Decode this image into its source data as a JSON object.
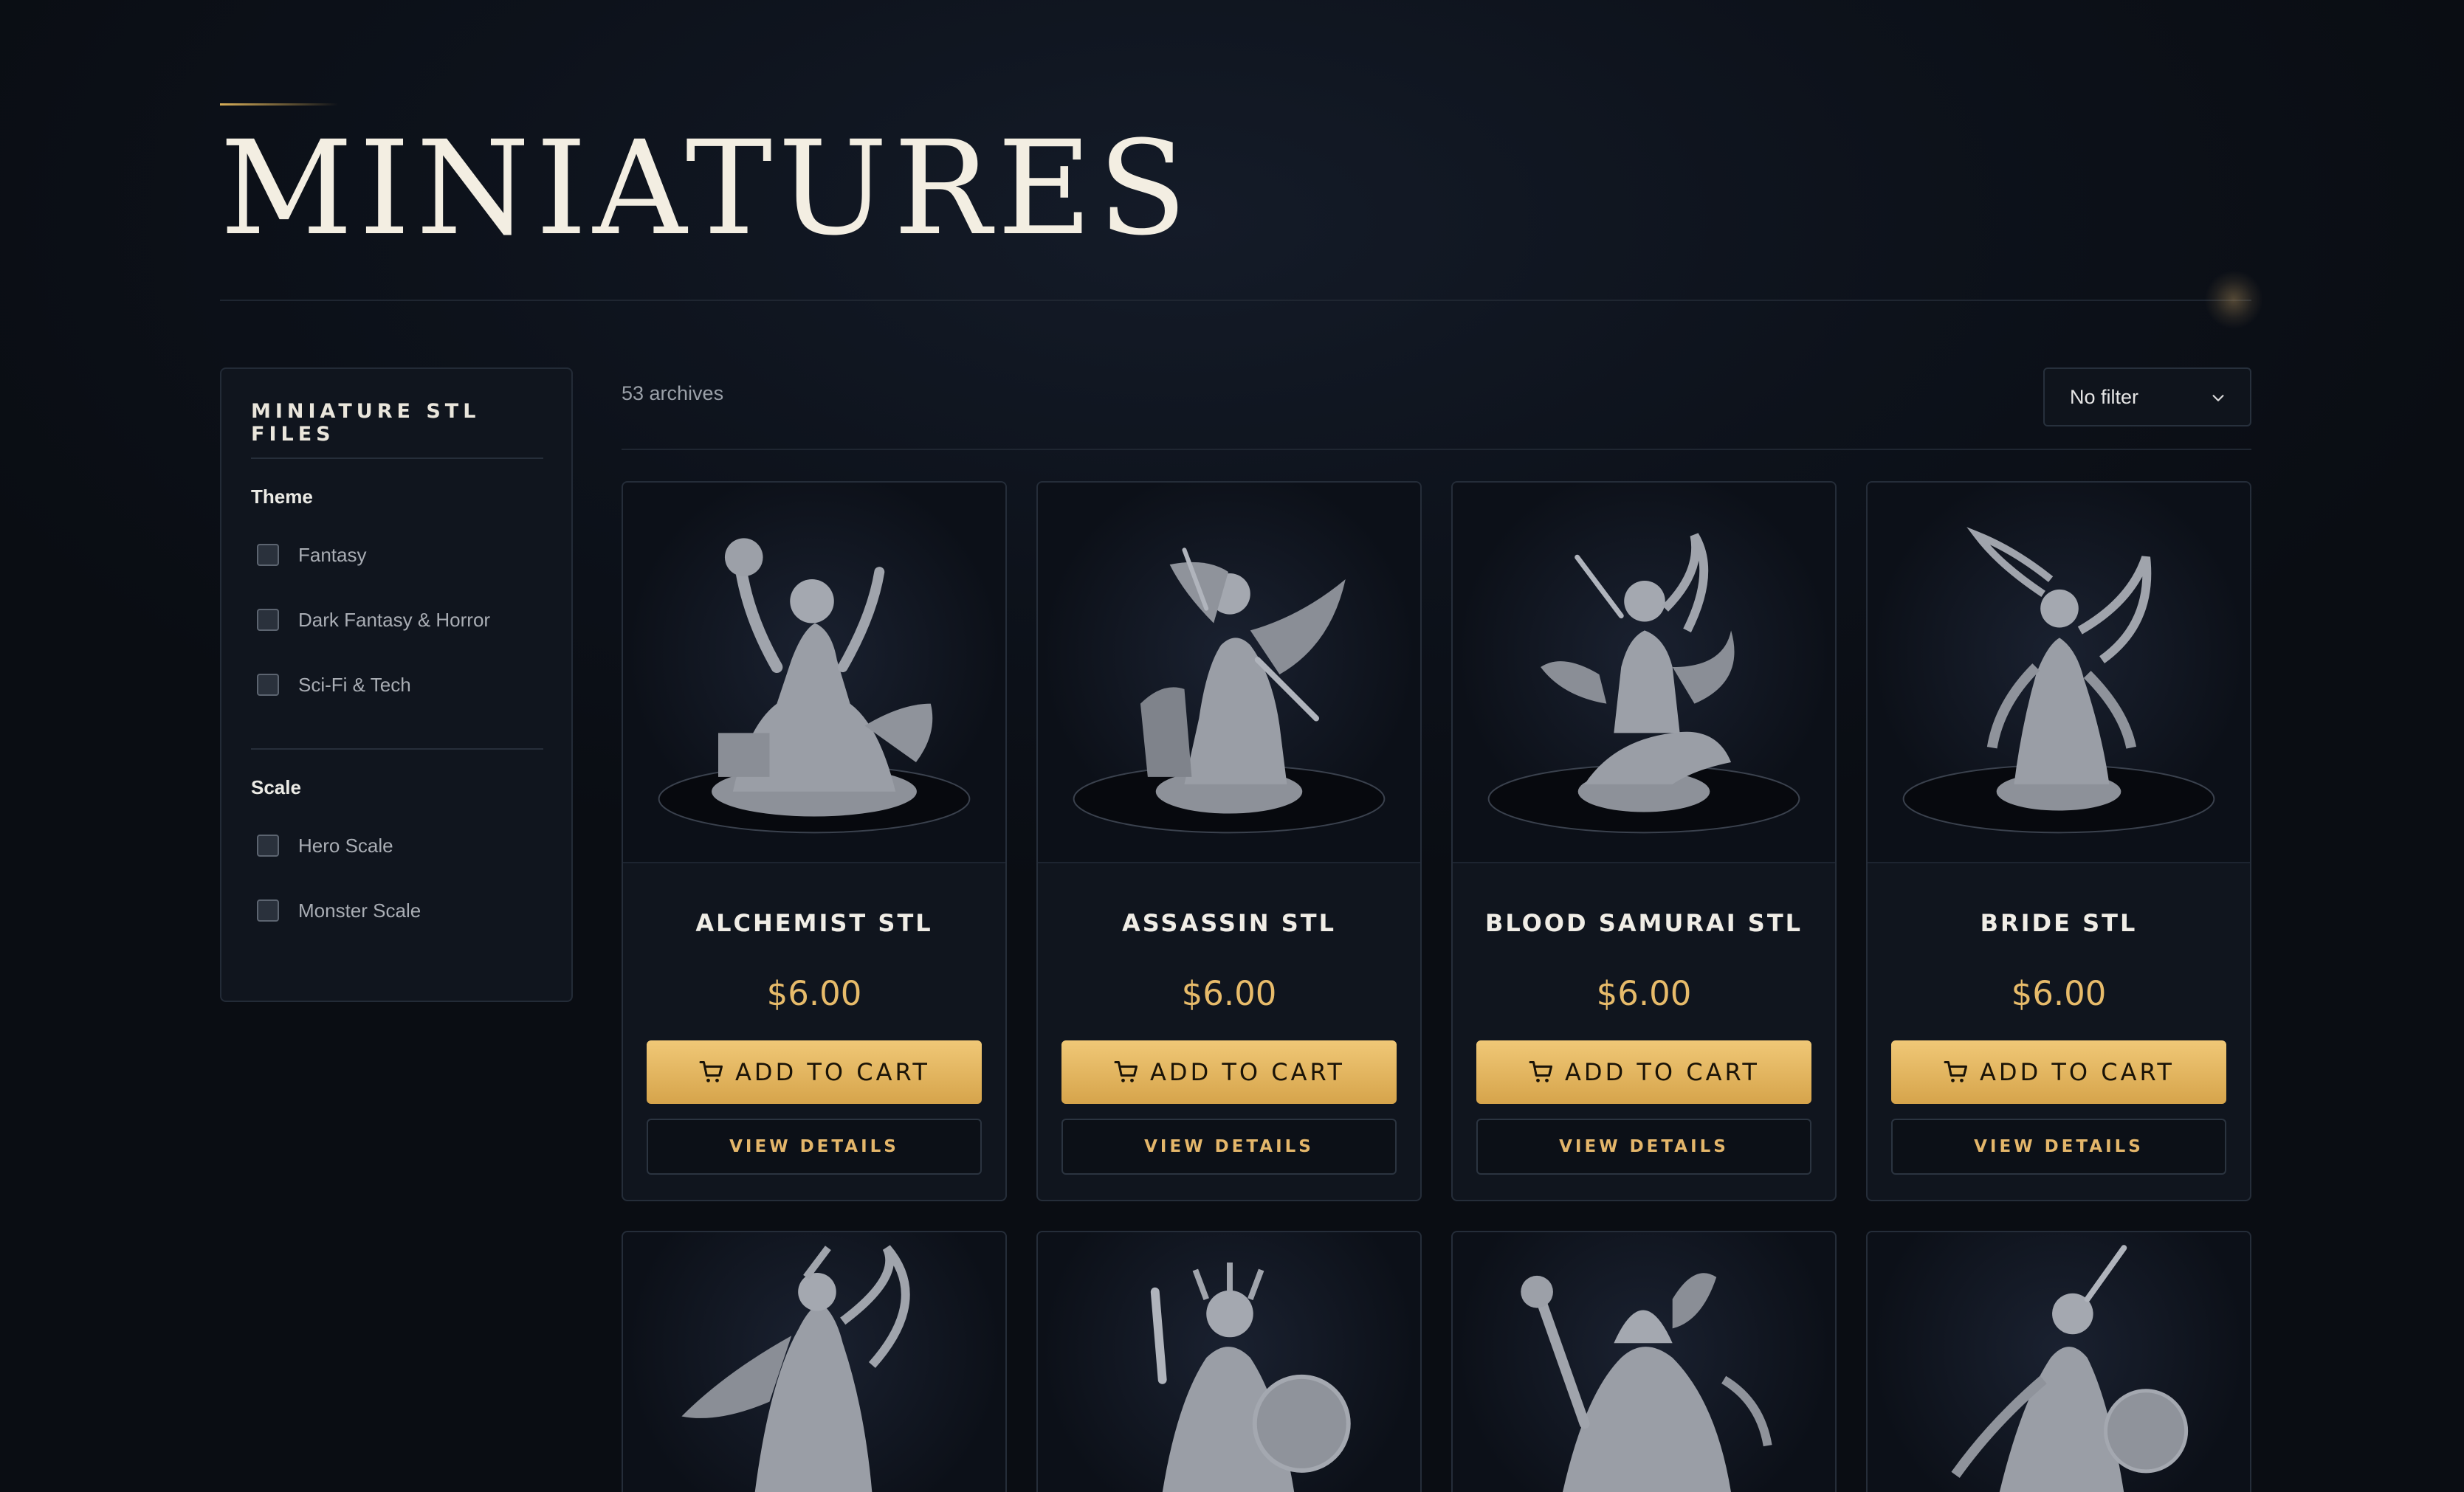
{
  "header": {
    "title": "MINIATURES"
  },
  "sidebar": {
    "title": "MINIATURE STL FILES",
    "groups": [
      {
        "heading": "Theme",
        "options": [
          {
            "label": "Fantasy",
            "checked": false
          },
          {
            "label": "Dark Fantasy & Horror",
            "checked": false
          },
          {
            "label": "Sci-Fi & Tech",
            "checked": false
          }
        ]
      },
      {
        "heading": "Scale",
        "options": [
          {
            "label": "Hero Scale",
            "checked": false
          },
          {
            "label": "Monster Scale",
            "checked": false
          }
        ]
      }
    ]
  },
  "toolbar": {
    "count_text": "53 archives",
    "sort_value": "No filter",
    "sort_icon": "chevron-down-icon"
  },
  "products": [
    {
      "name": "ALCHEMIST STL",
      "price": "$6.00",
      "cart_label": "ADD TO CART",
      "details_label": "VIEW DETAILS"
    },
    {
      "name": "ASSASSIN STL",
      "price": "$6.00",
      "cart_label": "ADD TO CART",
      "details_label": "VIEW DETAILS"
    },
    {
      "name": "BLOOD SAMURAI STL",
      "price": "$6.00",
      "cart_label": "ADD TO CART",
      "details_label": "VIEW DETAILS"
    },
    {
      "name": "BRIDE STL",
      "price": "$6.00",
      "cart_label": "ADD TO CART",
      "details_label": "VIEW DETAILS"
    }
  ],
  "colors": {
    "background": "#0c1017",
    "accent_gold": "#e7bb6a",
    "button_gold": "#deb05a",
    "card_border": "#252d39"
  },
  "icons": {
    "cart": "cart-icon",
    "chevron": "chevron-down-icon"
  }
}
